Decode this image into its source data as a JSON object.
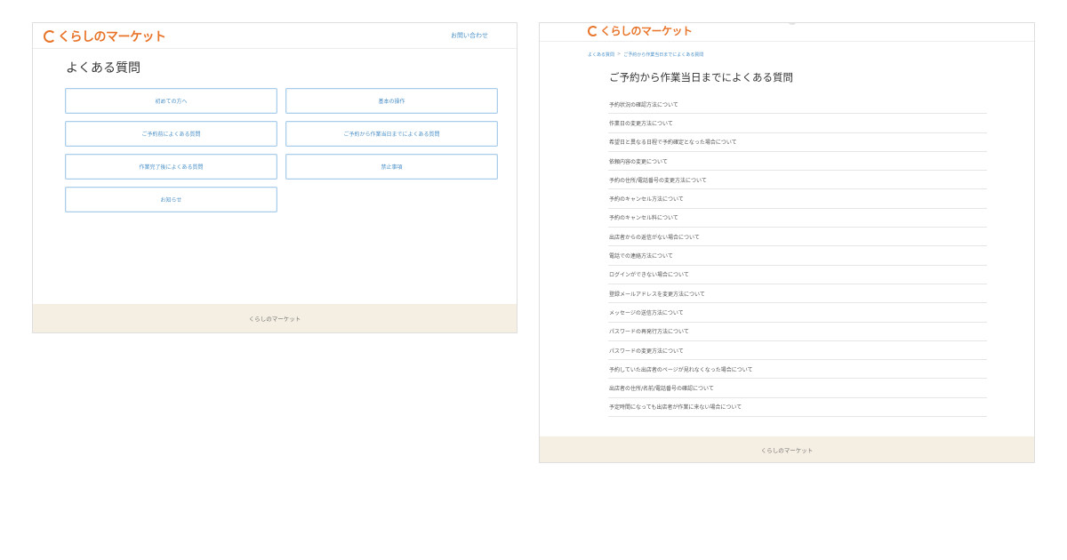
{
  "brand": {
    "name": "くらしのマーケット",
    "accent": "#e8742a",
    "link_color": "#4a90c8",
    "footer_bg": "#f5efe3"
  },
  "left": {
    "contact": "お問い合わせ",
    "title": "よくある質問",
    "categories": [
      "初めての方へ",
      "基本の操作",
      "ご予約前によくある質問",
      "ご予約から作業当日までによくある質問",
      "作業完了後によくある質問",
      "禁止事項",
      "お知らせ"
    ],
    "footer": "くらしのマーケット"
  },
  "right": {
    "breadcrumb": [
      "よくある質問",
      ">",
      "ご予約から作業当日までによくある質問"
    ],
    "title": "ご予約から作業当日までによくある質問",
    "items": [
      "予約状況の確認方法について",
      "作業日の変更方法について",
      "希望日と異なる日程で予約確定となった場合について",
      "依頼内容の変更について",
      "予約の住所/電話番号の変更方法について",
      "予約のキャンセル方法について",
      "予約のキャンセル料について",
      "出店者からの返信がない場合について",
      "電話での連絡方法について",
      "ログインができない場合について",
      "登録メールアドレスを変更方法について",
      "メッセージの送信方法について",
      "パスワードの再発行方法について",
      "パスワードの変更方法について",
      "予約していた出店者のページが見れなくなった場合について",
      "出店者の住所/名前/電話番号の確認について",
      "予定時間になっても出店者が作業に来ない場合について"
    ],
    "footer": "くらしのマーケット"
  }
}
